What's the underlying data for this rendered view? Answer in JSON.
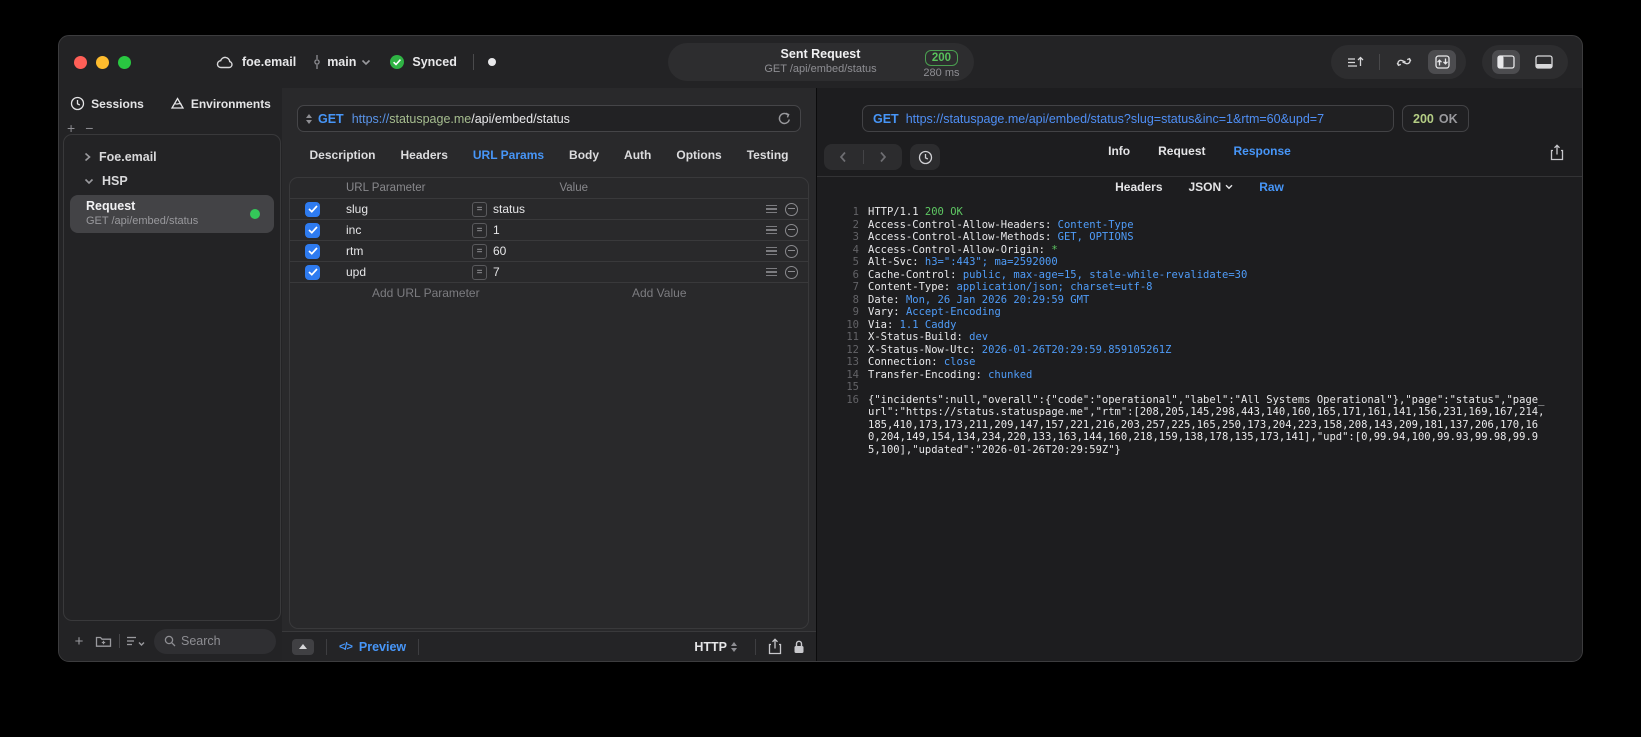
{
  "titlebar": {
    "project": "foe.email",
    "branch": "main",
    "sync_label": "Synced",
    "sent_request": {
      "title": "Sent Request",
      "subtitle": "GET /api/embed/status",
      "status_code": "200",
      "duration": "280 ms"
    }
  },
  "sidebar": {
    "tabs": [
      "Sessions",
      "Environments"
    ],
    "tree": [
      {
        "label": "Foe.email",
        "state": "collapsed"
      },
      {
        "label": "HSP",
        "state": "expanded"
      }
    ],
    "request_item": {
      "title": "Request",
      "subtitle": "GET /api/embed/status"
    },
    "search_placeholder": "Search"
  },
  "request_panel": {
    "method": "GET",
    "url": {
      "scheme": "https://",
      "host": "statuspage.me",
      "path": "/api/embed/status"
    },
    "tabs": [
      "Description",
      "Headers",
      "URL Params",
      "Body",
      "Auth",
      "Options",
      "Testing"
    ],
    "active_tab": "URL Params",
    "table": {
      "col_param": "URL Parameter",
      "col_value": "Value",
      "eq": "=",
      "rows": [
        {
          "name": "slug",
          "value": "status",
          "checked": true
        },
        {
          "name": "inc",
          "value": "1",
          "checked": true
        },
        {
          "name": "rtm",
          "value": "60",
          "checked": true
        },
        {
          "name": "upd",
          "value": "7",
          "checked": true
        }
      ],
      "add_param": "Add URL Parameter",
      "add_value": "Add Value"
    },
    "footer": {
      "preview_icon": "</>",
      "preview": "Preview",
      "protocol": "HTTP"
    }
  },
  "response_panel": {
    "method": "GET",
    "url": "https://statuspage.me/api/embed/status?slug=status&inc=1&rtm=60&upd=7",
    "status_code": "200",
    "status_text": "OK",
    "tabs": [
      "Info",
      "Request",
      "Response"
    ],
    "active_tab": "Response",
    "subtabs": [
      "Headers",
      "JSON",
      "Raw"
    ],
    "active_subtab": "Raw",
    "lines": [
      {
        "num": "1",
        "key": "HTTP/1.1 ",
        "val": "200 OK"
      },
      {
        "num": "2",
        "key": "Access-Control-Allow-Headers: ",
        "val": "Content-Type"
      },
      {
        "num": "3",
        "key": "Access-Control-Allow-Methods: ",
        "val": "GET, OPTIONS"
      },
      {
        "num": "4",
        "key": "Access-Control-Allow-Origin: ",
        "val": "*"
      },
      {
        "num": "5",
        "key": "Alt-Svc: ",
        "val": "h3=\":443\"; ma=2592000"
      },
      {
        "num": "6",
        "key": "Cache-Control: ",
        "val": "public, max-age=15, stale-while-revalidate=30"
      },
      {
        "num": "7",
        "key": "Content-Type: ",
        "val": "application/json; charset=utf-8"
      },
      {
        "num": "8",
        "key": "Date: ",
        "val": "Mon, 26 Jan 2026 20:29:59 GMT"
      },
      {
        "num": "9",
        "key": "Vary: ",
        "val": "Accept-Encoding"
      },
      {
        "num": "10",
        "key": "Via: ",
        "val": "1.1 Caddy"
      },
      {
        "num": "11",
        "key": "X-Status-Build: ",
        "val": "dev"
      },
      {
        "num": "12",
        "key": "X-Status-Now-Utc: ",
        "val": "2026-01-26T20:29:59.859105261Z"
      },
      {
        "num": "13",
        "key": "Connection: ",
        "val": "close"
      },
      {
        "num": "14",
        "key": "Transfer-Encoding: ",
        "val": "chunked"
      },
      {
        "num": "15",
        "key": "",
        "val": ""
      },
      {
        "num": "16",
        "key": "",
        "val": ""
      }
    ],
    "body": "{\"incidents\":null,\"overall\":{\"code\":\"operational\",\"label\":\"All Systems Operational\"},\"page\":\"status\",\"page_url\":\"https://status.statuspage.me\",\"rtm\":[208,205,145,298,443,140,160,165,171,161,141,156,231,169,167,214,185,410,173,173,211,209,147,157,221,216,203,257,225,165,250,173,204,223,158,208,143,209,181,137,206,170,160,204,149,154,134,234,220,133,163,144,160,218,159,138,178,135,173,141],\"upd\":[0,99.94,100,99.93,99.98,99.95,100],\"updated\":\"2026-01-26T20:29:59Z\"}"
  },
  "colors": {
    "accent_blue": "#4796f8",
    "status_green": "#57c15b",
    "checkbox_blue": "#2e7bf0",
    "header_value_blue": "#4f9cf8",
    "code_green": "#5ec763",
    "badge_200_green": "#b4cd84"
  }
}
